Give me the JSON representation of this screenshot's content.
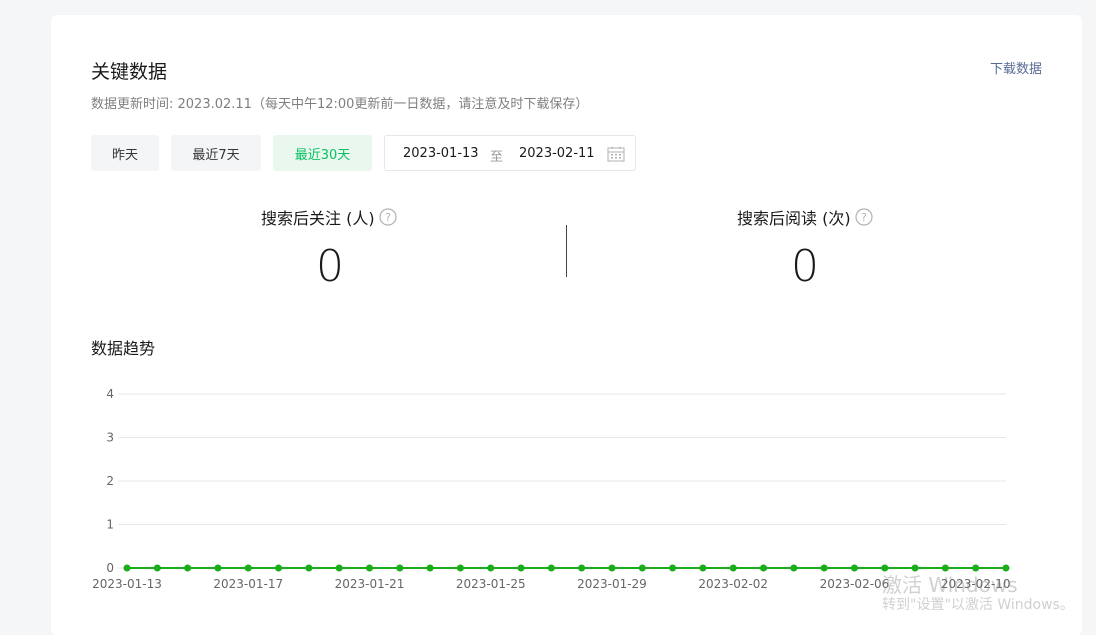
{
  "header": {
    "title": "关键数据",
    "download_label": "下载数据",
    "subtitle": "数据更新时间: 2023.02.11（每天中午12:00更新前一日数据，请注意及时下载保存）"
  },
  "range_buttons": [
    {
      "label": "昨天",
      "active": false
    },
    {
      "label": "最近7天",
      "active": false
    },
    {
      "label": "最近30天",
      "active": true
    }
  ],
  "date_range": {
    "start": "2023-01-13",
    "separator": "至",
    "end": "2023-02-11"
  },
  "metrics": [
    {
      "label": "搜索后关注 (人)",
      "value": "0"
    },
    {
      "label": "搜索后阅读 (次)",
      "value": "0"
    }
  ],
  "trend": {
    "title": "数据趋势"
  },
  "watermark": {
    "line1": "激活 Windows",
    "line2": "转到\"设置\"以激活 Windows。"
  },
  "colors": {
    "accent": "#07c160",
    "line": "#1aad19",
    "link": "#576b95"
  },
  "chart_data": {
    "type": "line",
    "x": [
      "2023-01-13",
      "2023-01-14",
      "2023-01-15",
      "2023-01-16",
      "2023-01-17",
      "2023-01-18",
      "2023-01-19",
      "2023-01-20",
      "2023-01-21",
      "2023-01-22",
      "2023-01-23",
      "2023-01-24",
      "2023-01-25",
      "2023-01-26",
      "2023-01-27",
      "2023-01-28",
      "2023-01-29",
      "2023-01-30",
      "2023-01-31",
      "2023-02-01",
      "2023-02-02",
      "2023-02-03",
      "2023-02-04",
      "2023-02-05",
      "2023-02-06",
      "2023-02-07",
      "2023-02-08",
      "2023-02-09",
      "2023-02-10",
      "2023-02-11"
    ],
    "x_tick_labels": [
      "2023-01-13",
      "2023-01-17",
      "2023-01-21",
      "2023-01-25",
      "2023-01-29",
      "2023-02-02",
      "2023-02-06",
      "2023-02-10"
    ],
    "series": [
      {
        "values": [
          0,
          0,
          0,
          0,
          0,
          0,
          0,
          0,
          0,
          0,
          0,
          0,
          0,
          0,
          0,
          0,
          0,
          0,
          0,
          0,
          0,
          0,
          0,
          0,
          0,
          0,
          0,
          0,
          0,
          0
        ]
      }
    ],
    "y_ticks": [
      0,
      1,
      2,
      3,
      4
    ],
    "ylim": [
      0,
      4
    ],
    "grid": true,
    "title": "",
    "xlabel": "",
    "ylabel": ""
  }
}
